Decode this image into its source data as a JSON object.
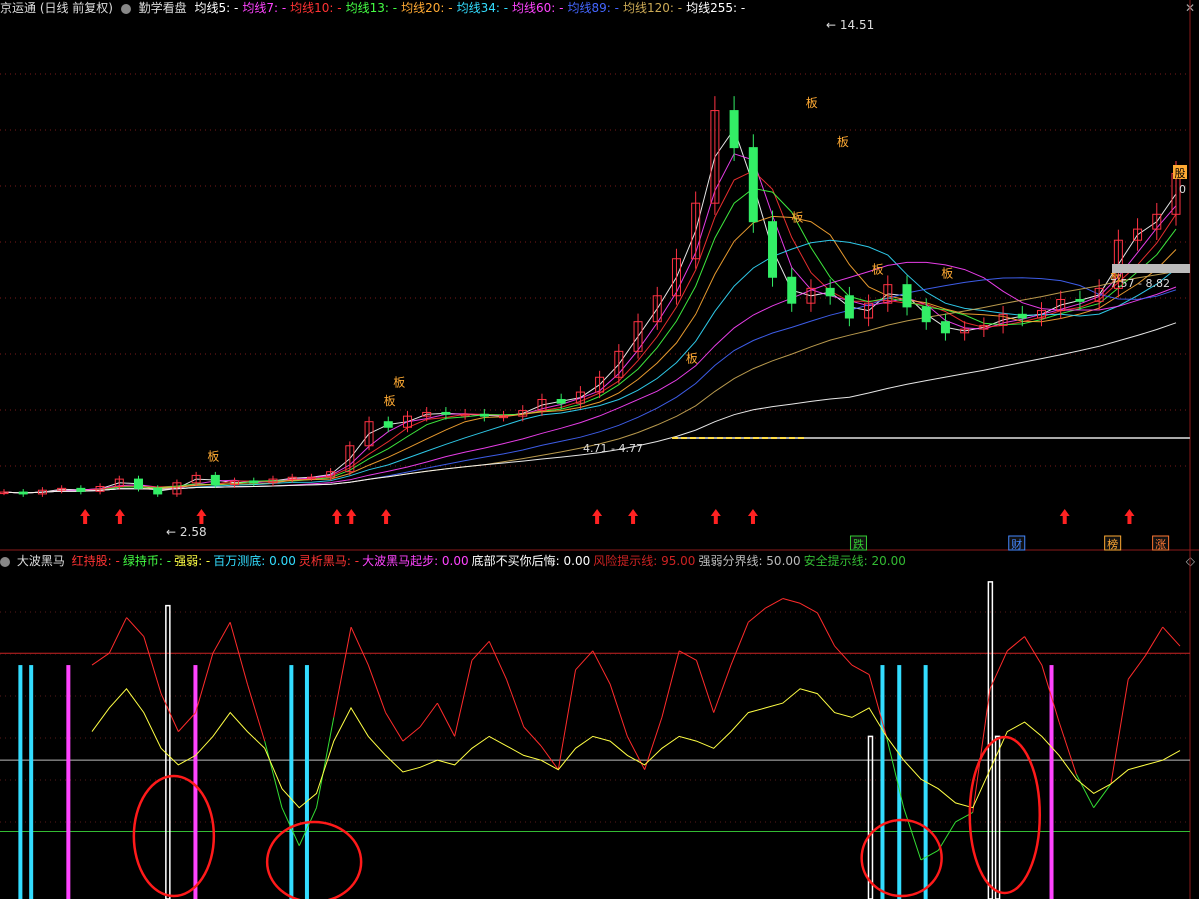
{
  "main_header": {
    "title": "京运通 (日线 前复权)",
    "panel": "勤学看盘",
    "ma_items": [
      {
        "label": "均线5:",
        "value": "-",
        "color": "#ffffff"
      },
      {
        "label": "均线7:",
        "value": "-",
        "color": "#ff44ff"
      },
      {
        "label": "均线10:",
        "value": "-",
        "color": "#ff3333"
      },
      {
        "label": "均线13:",
        "value": "-",
        "color": "#44ff44"
      },
      {
        "label": "均线20:",
        "value": "-",
        "color": "#ffaa33"
      },
      {
        "label": "均线34:",
        "value": "-",
        "color": "#33ddff"
      },
      {
        "label": "均线60:",
        "value": "-",
        "color": "#ff44ff"
      },
      {
        "label": "均线89:",
        "value": "-",
        "color": "#4466ff"
      },
      {
        "label": "均线120:",
        "value": "-",
        "color": "#ccaa55"
      },
      {
        "label": "均线255:",
        "value": "-",
        "color": "#ffffff"
      }
    ]
  },
  "indicator_header": {
    "title": "大波黑马",
    "items": [
      {
        "label": "红持股:",
        "value": "-",
        "color": "#ff3333"
      },
      {
        "label": "绿持币:",
        "value": "-",
        "color": "#44ff44"
      },
      {
        "label": "强弱:",
        "value": "-",
        "color": "#ffff44"
      },
      {
        "label": "百万测底:",
        "value": "0.00",
        "color": "#33ddff"
      },
      {
        "label": "灵析黑马:",
        "value": "-",
        "color": "#ff3333"
      },
      {
        "label": "大波黑马起步:",
        "value": "0.00",
        "color": "#ff44ff"
      },
      {
        "label": "底部不买你后悔:",
        "value": "0.00",
        "color": "#ffffff"
      },
      {
        "label": "风险提示线:",
        "value": "95.00",
        "color": "#cc2222"
      },
      {
        "label": "强弱分界线:",
        "value": "50.00",
        "color": "#bbbbbb"
      },
      {
        "label": "安全提示线:",
        "value": "20.00",
        "color": "#33bb33"
      }
    ]
  },
  "annotations": {
    "peak_label": "14.51",
    "low_label": "2.58",
    "range_mid": "4.71 - 4.77",
    "range_right": "7.57 - 8.82",
    "right_label": "0",
    "board_char": "板",
    "bottom_tags": [
      {
        "text": "跌",
        "color": "#33cc33",
        "pos": 0.716
      },
      {
        "text": "财",
        "color": "#4488ff",
        "pos": 0.848
      },
      {
        "text": "榜",
        "color": "#ffaa33",
        "pos": 0.928
      },
      {
        "text": "涨",
        "color": "#ff7733",
        "pos": 0.968
      }
    ],
    "side_tag": "股"
  },
  "chart_data": [
    {
      "type": "candlestick",
      "title": "京运通 (日线 前复权)",
      "ylim": [
        2.0,
        15.5
      ],
      "x": [
        0,
        5,
        10,
        15,
        20,
        25,
        30,
        35,
        40,
        45,
        50,
        55,
        60,
        65,
        70,
        75,
        80,
        85,
        90,
        95,
        100,
        105,
        110,
        115,
        120,
        125,
        130,
        135,
        140,
        145,
        150,
        155,
        160,
        165,
        170,
        175,
        180,
        185,
        190,
        195,
        200,
        205,
        210,
        215,
        220,
        225,
        230,
        235,
        240,
        245,
        250,
        255,
        260,
        265,
        270,
        275,
        280,
        285,
        290,
        295,
        300,
        305,
        310,
        315,
        320,
        325,
        330,
        335,
        340,
        345,
        350,
        355,
        360,
        365,
        370,
        375,
        380,
        385,
        390,
        395,
        400
      ],
      "close": [
        2.7,
        2.65,
        2.75,
        2.8,
        2.72,
        2.85,
        3.05,
        2.8,
        2.65,
        2.95,
        3.15,
        2.9,
        3.0,
        2.95,
        3.05,
        3.1,
        3.1,
        3.25,
        3.95,
        4.6,
        4.45,
        4.75,
        4.85,
        4.8,
        4.8,
        4.75,
        4.75,
        4.9,
        5.2,
        5.1,
        5.4,
        5.8,
        6.5,
        7.3,
        8.0,
        9.0,
        10.5,
        13.0,
        12.0,
        10.0,
        8.5,
        7.8,
        8.2,
        8.0,
        7.4,
        7.8,
        8.3,
        7.7,
        7.3,
        7.0,
        7.1,
        7.2,
        7.5,
        7.4,
        7.6,
        7.9,
        7.85,
        8.2,
        9.5,
        9.8,
        10.2,
        11.3
      ],
      "arrows_x_fraction": [
        0.071,
        0.1,
        0.168,
        0.281,
        0.293,
        0.322,
        0.498,
        0.528,
        0.597,
        0.628,
        0.888,
        0.942
      ],
      "board_marks": [
        {
          "x": 0.178,
          "price": 3.55
        },
        {
          "x": 0.333,
          "price": 5.55
        },
        {
          "x": 0.325,
          "price": 5.05
        },
        {
          "x": 0.577,
          "price": 6.2
        },
        {
          "x": 0.665,
          "price": 10.0
        },
        {
          "x": 0.677,
          "price": 13.1
        },
        {
          "x": 0.703,
          "price": 12.05
        },
        {
          "x": 0.732,
          "price": 8.6
        },
        {
          "x": 0.79,
          "price": 8.5
        },
        {
          "x": 0.931,
          "price": 8.4
        }
      ],
      "series_names": [
        "均线5",
        "均线7",
        "均线10",
        "均线13",
        "均线20",
        "均线34",
        "均线60",
        "均线89",
        "均线120",
        "均线255"
      ]
    },
    {
      "type": "line",
      "title": "大波黑马",
      "ylim": [
        0,
        130
      ],
      "reference_lines": [
        {
          "name": "风险提示线",
          "value": 95,
          "color": "#cc2222"
        },
        {
          "name": "强弱分界线",
          "value": 50,
          "color": "#bbbbbb"
        },
        {
          "name": "安全提示线",
          "value": 20,
          "color": "#33bb33"
        }
      ],
      "strength_line": [
        62,
        72,
        80,
        70,
        55,
        48,
        52,
        60,
        70,
        62,
        55,
        38,
        30,
        36,
        58,
        72,
        60,
        52,
        45,
        47,
        50,
        48,
        55,
        60,
        56,
        52,
        50,
        46,
        55,
        60,
        58,
        52,
        48,
        55,
        60,
        58,
        55,
        62,
        70,
        72,
        74,
        80,
        78,
        70,
        68,
        72,
        60,
        50,
        42,
        38,
        32,
        30,
        46,
        62,
        66,
        60,
        52,
        42,
        36,
        40,
        46,
        48,
        50,
        54
      ],
      "red_green_line": [
        90,
        95,
        110,
        102,
        78,
        62,
        70,
        95,
        108,
        82,
        58,
        30,
        14,
        30,
        68,
        106,
        90,
        70,
        58,
        64,
        74,
        60,
        92,
        100,
        84,
        64,
        56,
        46,
        88,
        96,
        82,
        60,
        46,
        68,
        96,
        92,
        70,
        90,
        108,
        114,
        118,
        116,
        112,
        98,
        90,
        86,
        60,
        30,
        8,
        12,
        24,
        28,
        80,
        96,
        102,
        90,
        66,
        44,
        30,
        40,
        84,
        94,
        106,
        98
      ],
      "cyan_bars": [
        0.017,
        0.026,
        0.243,
        0.256,
        0.736,
        0.75,
        0.772
      ],
      "magenta_bars": [
        0.057,
        0.163,
        0.877
      ],
      "white_bars": [
        0.14,
        0.726,
        0.826,
        0.832
      ],
      "circle_marks": [
        0.145,
        0.262,
        0.752,
        0.838
      ]
    }
  ]
}
